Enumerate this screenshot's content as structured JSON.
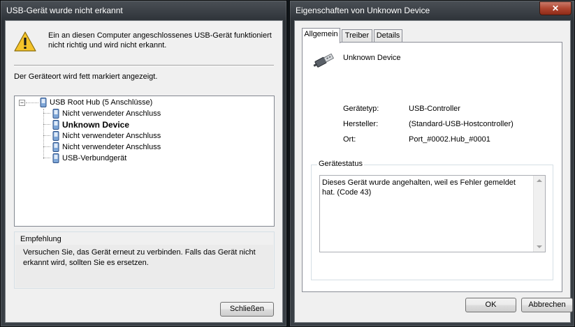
{
  "window1": {
    "title": "USB-Gerät wurde nicht erkannt",
    "message": "Ein an diesen Computer angeschlossenes USB-Gerät funktioniert nicht richtig und wird nicht erkannt.",
    "hint": "Der Geräteort wird fett markiert angezeigt.",
    "tree": {
      "root": "USB Root Hub (5 Anschlüsse)",
      "root_expander": "−",
      "children": [
        "Nicht verwendeter Anschluss",
        "Unknown Device",
        "Nicht verwendeter Anschluss",
        "Nicht verwendeter Anschluss",
        "USB-Verbundgerät"
      ]
    },
    "recommendation_title": "Empfehlung",
    "recommendation_text": "Versuchen Sie, das Gerät erneut zu verbinden. Falls das Gerät nicht erkannt wird, sollten Sie es ersetzen.",
    "close_button": "Schließen"
  },
  "window2": {
    "title": "Eigenschaften von Unknown Device",
    "close_glyph": "✕",
    "tabs": [
      "Allgemein",
      "Treiber",
      "Details"
    ],
    "device_name": "Unknown Device",
    "props": [
      {
        "key": "Gerätetyp:",
        "value": "USB-Controller"
      },
      {
        "key": "Hersteller:",
        "value": "(Standard-USB-Hostcontroller)"
      },
      {
        "key": "Ort:",
        "value": "Port_#0002.Hub_#0001"
      }
    ],
    "status_title": "Gerätestatus",
    "status_text": "Dieses Gerät wurde angehalten, weil es Fehler gemeldet hat. (Code 43)",
    "ok_button": "OK",
    "cancel_button": "Abbrechen"
  }
}
